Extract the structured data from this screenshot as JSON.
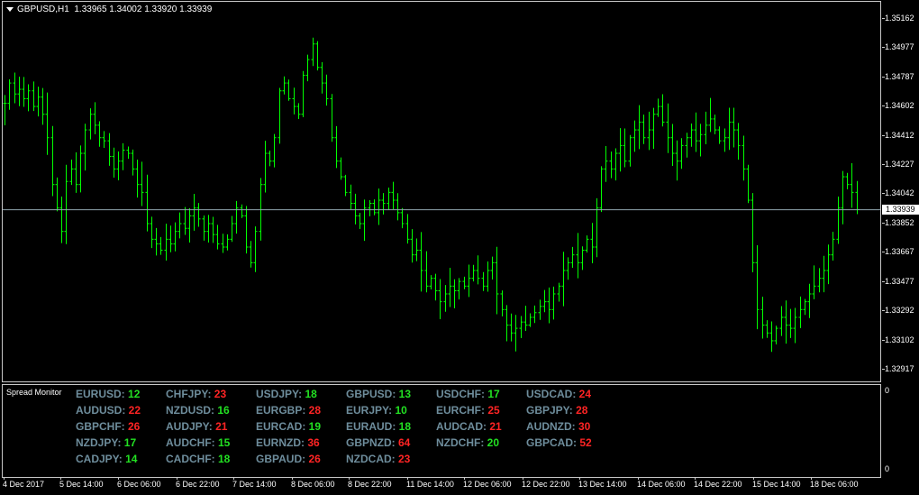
{
  "chart": {
    "symbol_timeframe": "GBPUSD,H1",
    "ohlc": "1.33965 1.34002 1.33920 1.33939",
    "current_price": "1.33939",
    "bar_color": "#00ff00",
    "background": "#000000"
  },
  "price_axis": {
    "labels": [
      "1.35162",
      "1.34977",
      "1.34787",
      "1.34602",
      "1.34412",
      "1.34227",
      "1.34042",
      "1.33852",
      "1.33667",
      "1.33477",
      "1.33292",
      "1.33102",
      "1.32917"
    ]
  },
  "spread_monitor": {
    "title": "Spread Monitor",
    "columns": [
      [
        {
          "pair": "EURUSD:",
          "value": "12",
          "status": "green"
        },
        {
          "pair": "AUDUSD:",
          "value": "22",
          "status": "red"
        },
        {
          "pair": "GBPCHF:",
          "value": "26",
          "status": "red"
        },
        {
          "pair": "NZDJPY:",
          "value": "17",
          "status": "green"
        },
        {
          "pair": "CADJPY:",
          "value": "14",
          "status": "green"
        }
      ],
      [
        {
          "pair": "CHFJPY:",
          "value": "23",
          "status": "red"
        },
        {
          "pair": "NZDUSD:",
          "value": "16",
          "status": "green"
        },
        {
          "pair": "AUDJPY:",
          "value": "21",
          "status": "red"
        },
        {
          "pair": "AUDCHF:",
          "value": "15",
          "status": "green"
        },
        {
          "pair": "CADCHF:",
          "value": "18",
          "status": "green"
        }
      ],
      [
        {
          "pair": "USDJPY:",
          "value": "18",
          "status": "green"
        },
        {
          "pair": "EURGBP:",
          "value": "28",
          "status": "red"
        },
        {
          "pair": "EURCAD:",
          "value": "19",
          "status": "green"
        },
        {
          "pair": "EURNZD:",
          "value": "36",
          "status": "red"
        },
        {
          "pair": "GBPAUD:",
          "value": "26",
          "status": "red"
        }
      ],
      [
        {
          "pair": "GBPUSD:",
          "value": "13",
          "status": "green"
        },
        {
          "pair": "EURJPY:",
          "value": "10",
          "status": "green"
        },
        {
          "pair": "EURAUD:",
          "value": "18",
          "status": "green"
        },
        {
          "pair": "GBPNZD:",
          "value": "64",
          "status": "red"
        },
        {
          "pair": "NZDCAD:",
          "value": "23",
          "status": "red"
        }
      ],
      [
        {
          "pair": "USDCHF:",
          "value": "17",
          "status": "green"
        },
        {
          "pair": "EURCHF:",
          "value": "25",
          "status": "red"
        },
        {
          "pair": "AUDCAD:",
          "value": "21",
          "status": "red"
        },
        {
          "pair": "NZDCHF:",
          "value": "20",
          "status": "green"
        }
      ],
      [
        {
          "pair": "USDCAD:",
          "value": "24",
          "status": "red"
        },
        {
          "pair": "GBPJPY:",
          "value": "28",
          "status": "red"
        },
        {
          "pair": "AUDNZD:",
          "value": "30",
          "status": "red"
        },
        {
          "pair": "GBPCAD:",
          "value": "52",
          "status": "red"
        }
      ]
    ],
    "axis_top": "0",
    "axis_bottom": "0"
  },
  "time_axis": {
    "labels": [
      "4 Dec 2017",
      "5 Dec 14:00",
      "6 Dec 06:00",
      "6 Dec 22:00",
      "7 Dec 14:00",
      "8 Dec 06:00",
      "8 Dec 22:00",
      "11 Dec 14:00",
      "12 Dec 06:00",
      "12 Dec 22:00",
      "13 Dec 14:00",
      "14 Dec 06:00",
      "14 Dec 22:00",
      "15 Dec 14:00",
      "18 Dec 06:00"
    ]
  },
  "chart_data": {
    "type": "ohlc",
    "price_range": [
      1.3284,
      1.3527
    ],
    "closes": [
      1.3462,
      1.3475,
      1.3468,
      1.3471,
      1.3465,
      1.347,
      1.346,
      1.3466,
      1.3455,
      1.344,
      1.341,
      1.3395,
      1.338,
      1.3412,
      1.342,
      1.341,
      1.343,
      1.3445,
      1.3455,
      1.3448,
      1.344,
      1.3438,
      1.3428,
      1.342,
      1.3425,
      1.3432,
      1.343,
      1.342,
      1.341,
      1.3405,
      1.3385,
      1.3375,
      1.3372,
      1.3368,
      1.3375,
      1.3372,
      1.338,
      1.3385,
      1.3382,
      1.339,
      1.3395,
      1.3388,
      1.338,
      1.3385,
      1.3378,
      1.3372,
      1.337,
      1.3375,
      1.3385,
      1.3395,
      1.339,
      1.337,
      1.336,
      1.338,
      1.341,
      1.343,
      1.3425,
      1.344,
      1.347,
      1.3475,
      1.3465,
      1.346,
      1.3455,
      1.348,
      1.349,
      1.35,
      1.3485,
      1.3475,
      1.3465,
      1.344,
      1.3425,
      1.3415,
      1.3405,
      1.3398,
      1.339,
      1.3385,
      1.3395,
      1.3398,
      1.3392,
      1.34,
      1.3398,
      1.3405,
      1.34,
      1.3392,
      1.3385,
      1.3375,
      1.3365,
      1.3368,
      1.3355,
      1.3345,
      1.335,
      1.3342,
      1.3335,
      1.334,
      1.3345,
      1.3342,
      1.3348,
      1.3345,
      1.335,
      1.3355,
      1.335,
      1.3345,
      1.3355,
      1.336,
      1.334,
      1.333,
      1.332,
      1.3315,
      1.3318,
      1.3322,
      1.332,
      1.3325,
      1.3328,
      1.3332,
      1.3335,
      1.333,
      1.334,
      1.3345,
      1.3355,
      1.336,
      1.3365,
      1.336,
      1.3368,
      1.3375,
      1.337,
      1.3395,
      1.342,
      1.3425,
      1.342,
      1.343,
      1.3435,
      1.3425,
      1.344,
      1.3445,
      1.345,
      1.344,
      1.3445,
      1.3455,
      1.346,
      1.345,
      1.344,
      1.343,
      1.3425,
      1.3435,
      1.344,
      1.3445,
      1.3438,
      1.3442,
      1.3448,
      1.3452,
      1.3445,
      1.3438,
      1.344,
      1.345,
      1.3445,
      1.3435,
      1.342,
      1.34,
      1.336,
      1.333,
      1.332,
      1.3315,
      1.331,
      1.3318,
      1.3325,
      1.332,
      1.3318,
      1.3325,
      1.333,
      1.3335,
      1.334,
      1.3345,
      1.335,
      1.3355,
      1.3365,
      1.3375,
      1.3395,
      1.3415,
      1.341,
      1.3405,
      1.3394
    ]
  }
}
